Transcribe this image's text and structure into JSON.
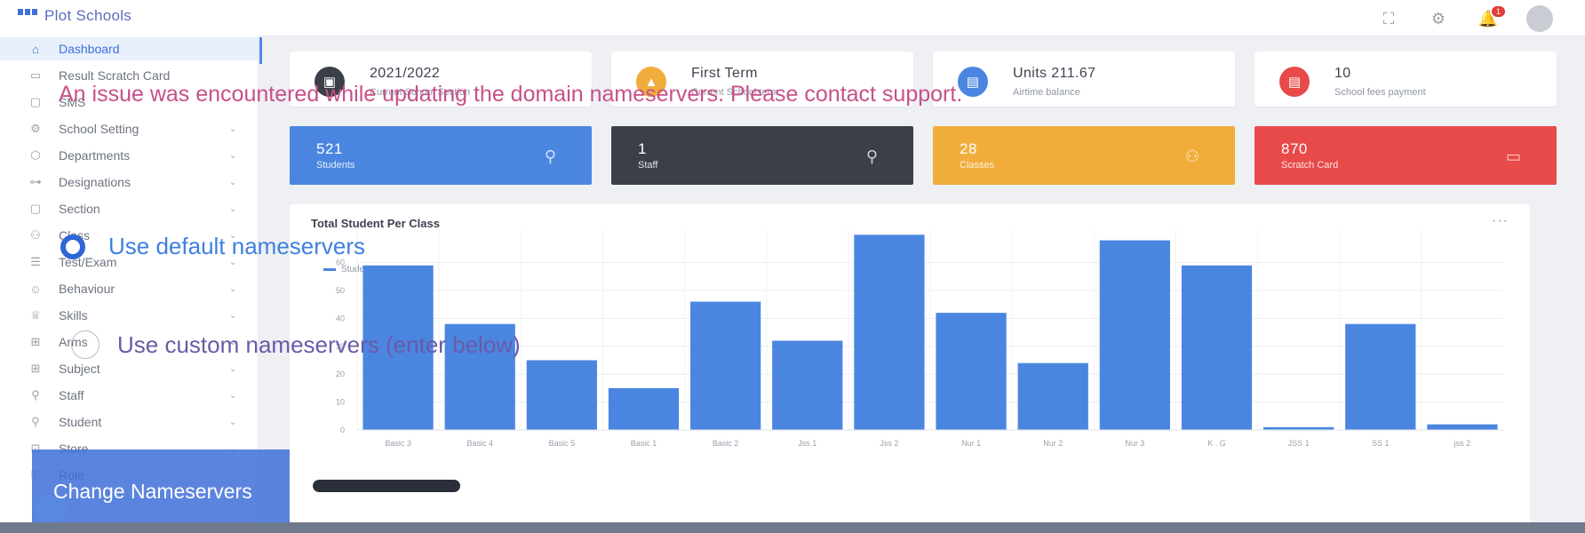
{
  "app": {
    "title": "Plot Schools"
  },
  "topbar": {
    "icons": [
      "fullscreen-icon",
      "gear-icon",
      "bell-icon",
      "user-avatar"
    ],
    "notification_count": "1"
  },
  "sidebar": {
    "items": [
      {
        "label": "Dashboard",
        "icon": "home-icon",
        "active": true,
        "expandable": false
      },
      {
        "label": "Result Scratch Card",
        "icon": "card-icon",
        "active": false,
        "expandable": false
      },
      {
        "label": "SMS",
        "icon": "message-icon",
        "active": false,
        "expandable": false
      },
      {
        "label": "School Setting",
        "icon": "gear-icon",
        "active": false,
        "expandable": true
      },
      {
        "label": "Departments",
        "icon": "cube-icon",
        "active": false,
        "expandable": true
      },
      {
        "label": " Designations",
        "icon": "tree-icon",
        "active": false,
        "expandable": true
      },
      {
        "label": "Section",
        "icon": "box-icon",
        "active": false,
        "expandable": true
      },
      {
        "label": "Class",
        "icon": "users-icon",
        "active": false,
        "expandable": true
      },
      {
        "label": "Test/Exam",
        "icon": "list-icon",
        "active": false,
        "expandable": true
      },
      {
        "label": "Behaviour",
        "icon": "smile-icon",
        "active": false,
        "expandable": true
      },
      {
        "label": "Skills",
        "icon": "trophy-icon",
        "active": false,
        "expandable": true
      },
      {
        "label": "Arms",
        "icon": "grid-icon",
        "active": false,
        "expandable": true
      },
      {
        "label": "Subject",
        "icon": "grid-icon",
        "active": false,
        "expandable": true
      },
      {
        "label": "Staff",
        "icon": "user-icon",
        "active": false,
        "expandable": true
      },
      {
        "label": "Student",
        "icon": "user-icon",
        "active": false,
        "expandable": true
      },
      {
        "label": "Store",
        "icon": "store-icon",
        "active": false,
        "expandable": true
      },
      {
        "label": "Role",
        "icon": "key-icon",
        "active": false,
        "expandable": false
      }
    ]
  },
  "info_cards": [
    {
      "value": "2021/2022",
      "label": "Current School Section",
      "color": "#3b3f47",
      "icon": "calendar-icon"
    },
    {
      "value": "First Term",
      "label": "Current School term",
      "color": "#f1ad3c",
      "icon": "triangle-icon"
    },
    {
      "value": "Units 211.67",
      "label": "Airtime balance",
      "color": "#4a86e0",
      "icon": "wallet-icon"
    },
    {
      "value": "10",
      "label": "School fees payment",
      "color": "#e84a4a",
      "icon": "wallet-icon"
    }
  ],
  "stat_cards": [
    {
      "value": "521",
      "label": "Students",
      "color": "#4a86e0",
      "icon": "user-icon"
    },
    {
      "value": "1",
      "label": "Staff",
      "color": "#3b3f47",
      "icon": "user-icon"
    },
    {
      "value": "28",
      "label": "Classes",
      "color": "#f1ad3c",
      "icon": "users-icon"
    },
    {
      "value": "870",
      "label": "Scratch Card",
      "color": "#e84a4a",
      "icon": "card-icon"
    }
  ],
  "chart": {
    "menu": "···"
  },
  "chart_data": {
    "type": "bar",
    "title": "Total Student Per Class",
    "legend": "Student",
    "legend_position": "top-left",
    "grid": true,
    "categories": [
      "Basic 3",
      "Basic 4",
      "Basic 5",
      "Basic 1",
      "Basic 2",
      "Jss 1",
      "Jss 2",
      "Nur 1",
      "Nur 2",
      "Nur 3",
      "K . G",
      "JSS 1",
      "SS 1",
      "jss 2"
    ],
    "values": [
      59,
      38,
      25,
      15,
      46,
      32,
      70,
      42,
      24,
      68,
      59,
      1,
      38,
      2
    ],
    "yticks": [
      0,
      10,
      20,
      30,
      40,
      50,
      60
    ],
    "ylim": [
      0,
      72
    ],
    "bar_color": "#4a86e0"
  },
  "overlay": {
    "message": "An issue was encountered while updating the domain nameservers. Please contact support.",
    "option_default": "Use default nameservers",
    "option_custom": "Use custom nameservers (enter below)",
    "button": "Change Nameservers",
    "progress": 0.9
  }
}
